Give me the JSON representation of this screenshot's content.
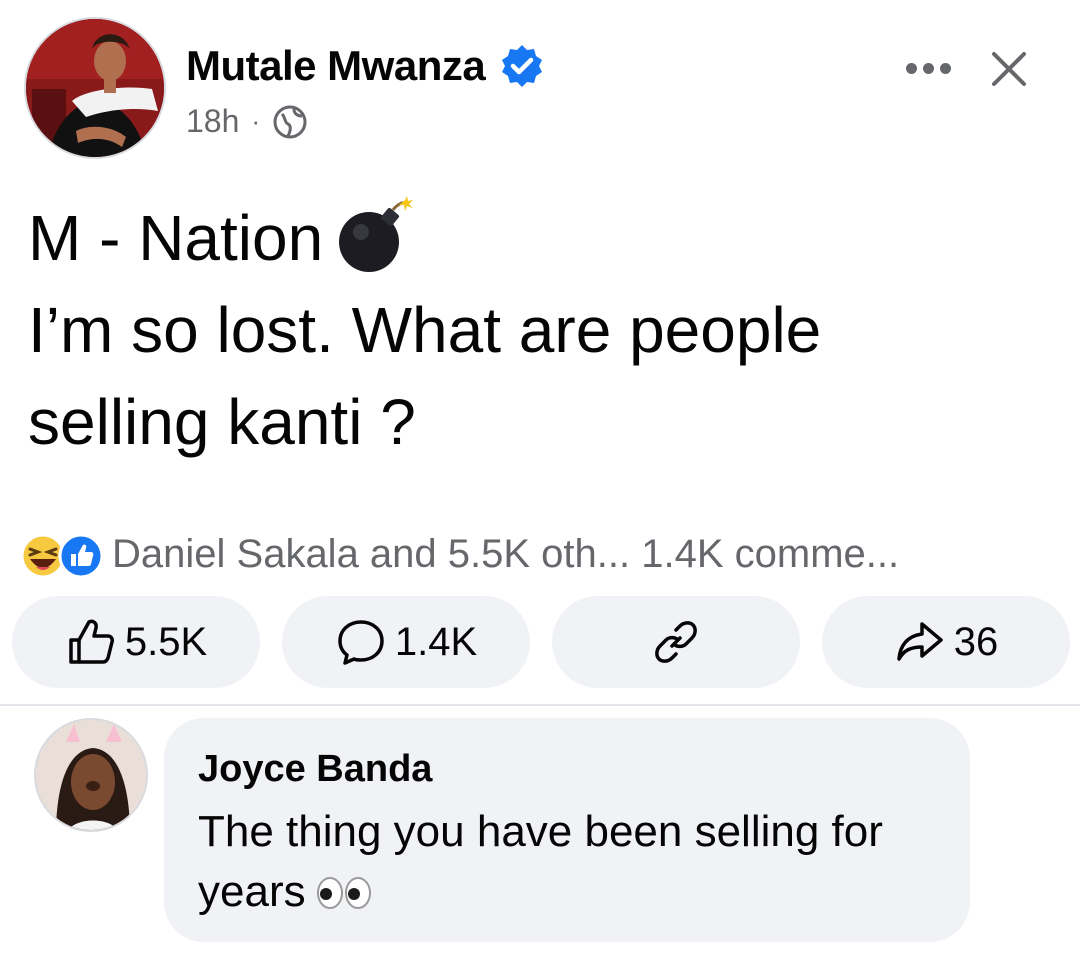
{
  "post": {
    "author_name": "Mutale Mwanza",
    "timestamp": "18h",
    "separator": "·",
    "audience_icon": "globe-icon",
    "verified_icon": "verified-badge-icon",
    "lines": [
      "M - Nation",
      "I’m so lost. What are people",
      "selling kanti ?"
    ],
    "emoji": "bomb"
  },
  "reactions": {
    "types": [
      "haha",
      "like"
    ],
    "summary_text": "Daniel Sakala and 5.5K oth... 1.4K comme..."
  },
  "actions": {
    "like_count": "5.5K",
    "comment_count": "1.4K",
    "share_count": "36",
    "icons": [
      "like-icon",
      "comment-icon",
      "link-icon",
      "share-icon"
    ]
  },
  "comment": {
    "author_name": "Joyce Banda",
    "text_line1": "The thing you have been selling for",
    "text_line2": "years",
    "emoji": "eyes"
  },
  "colors": {
    "text": "#050505",
    "secondary_text": "#65676b",
    "facebook_blue": "#1877f2",
    "button_bg": "#f0f2f5",
    "divider": "#e4e6eb"
  }
}
